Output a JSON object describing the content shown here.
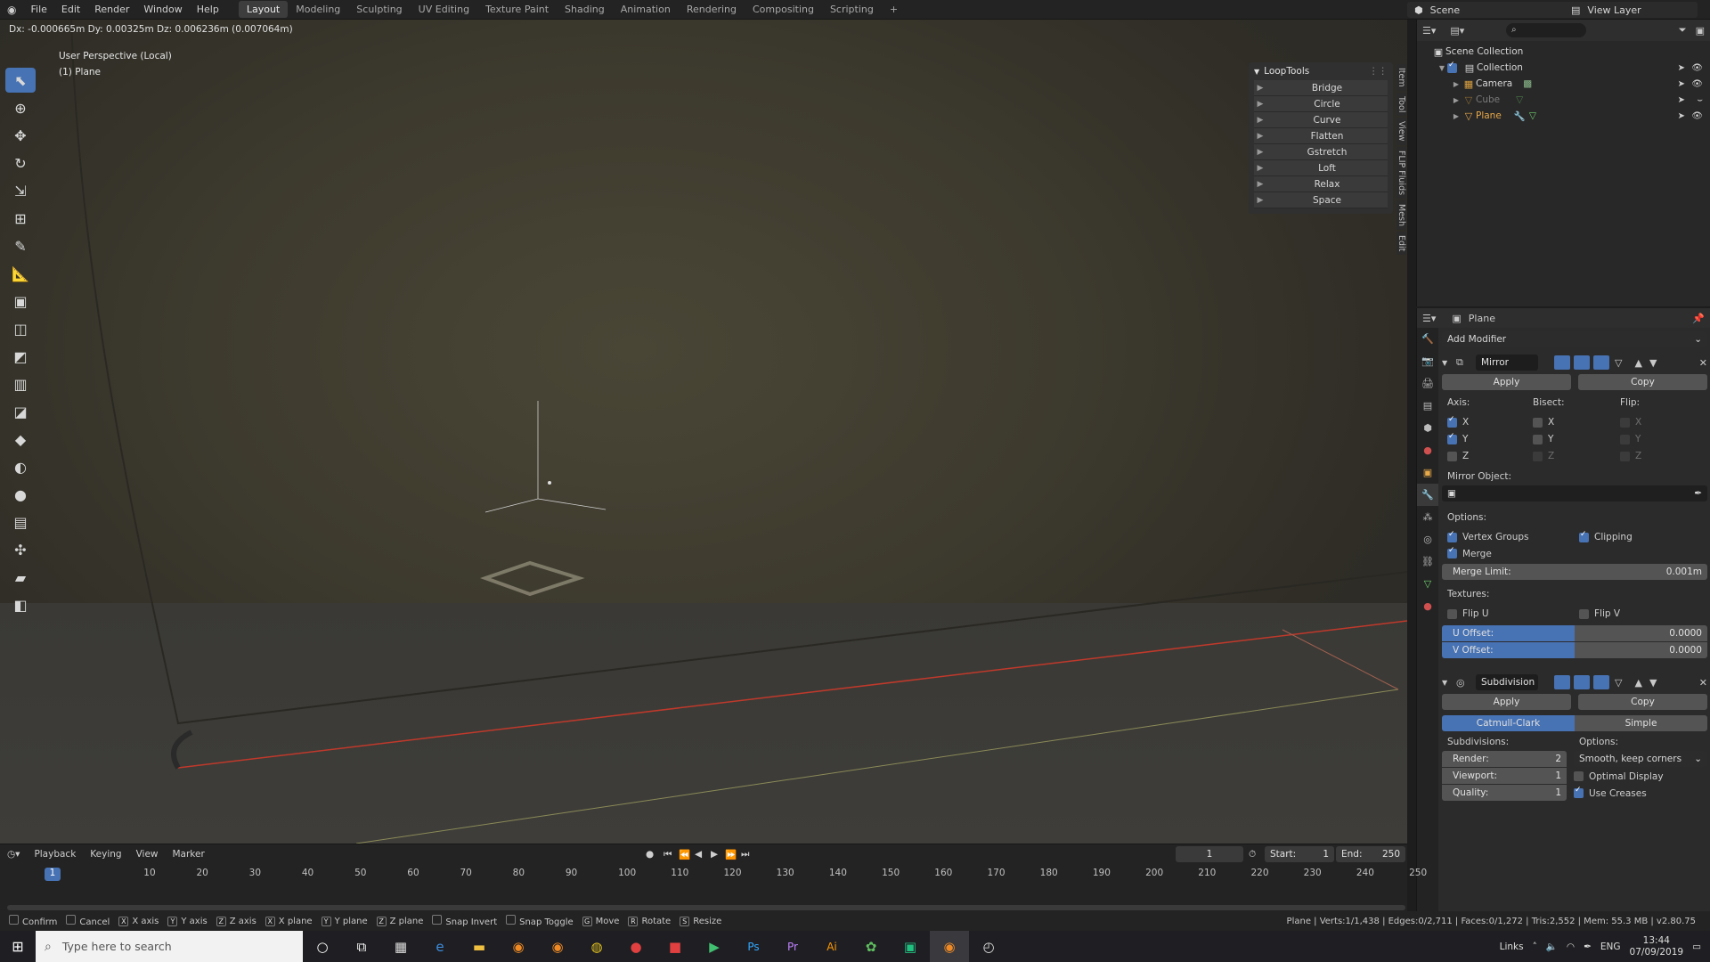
{
  "topbar": {
    "menus": [
      "File",
      "Edit",
      "Render",
      "Window",
      "Help"
    ],
    "workspaces": [
      "Layout",
      "Modeling",
      "Sculpting",
      "UV Editing",
      "Texture Paint",
      "Shading",
      "Animation",
      "Rendering",
      "Compositing",
      "Scripting"
    ],
    "active_workspace": "Layout",
    "scene": "Scene",
    "view_layer": "View Layer"
  },
  "viewport": {
    "header_text": "Dx: -0.000665m  Dy: 0.00325m  Dz: 0.006236m (0.007064m)",
    "perspective": "User Perspective (Local)",
    "object": "(1) Plane"
  },
  "looptools": {
    "title": "LoopTools",
    "items": [
      "Bridge",
      "Circle",
      "Curve",
      "Flatten",
      "Gstretch",
      "Loft",
      "Relax",
      "Space"
    ]
  },
  "side_tabs": [
    "Item",
    "Tool",
    "View",
    "FLIP Fluids",
    "Mesh",
    "Edit"
  ],
  "outliner": {
    "root": "Scene Collection",
    "collection": "Collection",
    "items": [
      {
        "name": "Camera",
        "color": "#d6d6d6"
      },
      {
        "name": "Cube",
        "color": "#7a7a7a"
      },
      {
        "name": "Plane",
        "color": "#e8a94a"
      }
    ]
  },
  "properties": {
    "object": "Plane",
    "add_modifier": "Add Modifier",
    "mirror": {
      "name": "Mirror",
      "apply": "Apply",
      "copy": "Copy",
      "axis_label": "Axis:",
      "bisect_label": "Bisect:",
      "flip_label": "Flip:",
      "axis": [
        "X",
        "Y",
        "Z"
      ],
      "mirror_object_label": "Mirror Object:",
      "options_label": "Options:",
      "vertex_groups": "Vertex Groups",
      "clipping": "Clipping",
      "merge": "Merge",
      "merge_limit_label": "Merge Limit:",
      "merge_limit": "0.001m",
      "textures_label": "Textures:",
      "flip_u": "Flip U",
      "flip_v": "Flip V",
      "u_offset_label": "U Offset:",
      "u_offset": "0.0000",
      "v_offset_label": "V Offset:",
      "v_offset": "0.0000"
    },
    "subdivision": {
      "name": "Subdivision",
      "apply": "Apply",
      "copy": "Copy",
      "catmull": "Catmull-Clark",
      "simple": "Simple",
      "subdivisions_label": "Subdivisions:",
      "options_label": "Options:",
      "render_label": "Render:",
      "render": "2",
      "viewport_label": "Viewport:",
      "viewport": "1",
      "quality_label": "Quality:",
      "quality": "1",
      "uv_smooth": "Smooth, keep corners",
      "optimal_display": "Optimal Display",
      "use_creases": "Use Creases"
    }
  },
  "timeline": {
    "menus": [
      "Playback",
      "Keying",
      "View",
      "Marker"
    ],
    "current_frame": "1",
    "start_label": "Start:",
    "start": "1",
    "end_label": "End:",
    "end": "250",
    "ticks": [
      "10",
      "20",
      "30",
      "40",
      "50",
      "60",
      "70",
      "80",
      "90",
      "100",
      "110",
      "120",
      "130",
      "140",
      "150",
      "160",
      "170",
      "180",
      "190",
      "200",
      "210",
      "220",
      "230",
      "240",
      "250"
    ],
    "frame_marker": "1"
  },
  "statusbar": {
    "items": [
      {
        "key": "",
        "label": "Confirm"
      },
      {
        "key": "",
        "label": "Cancel"
      },
      {
        "key": "X",
        "label": "X axis"
      },
      {
        "key": "Y",
        "label": "Y axis"
      },
      {
        "key": "Z",
        "label": "Z axis"
      },
      {
        "key": "X",
        "label": "X plane"
      },
      {
        "key": "Y",
        "label": "Y plane"
      },
      {
        "key": "Z",
        "label": "Z plane"
      },
      {
        "key": "",
        "label": "Snap Invert"
      },
      {
        "key": "",
        "label": "Snap Toggle"
      },
      {
        "key": "G",
        "label": "Move"
      },
      {
        "key": "R",
        "label": "Rotate"
      },
      {
        "key": "S",
        "label": "Resize"
      }
    ],
    "stats": "Plane | Verts:1/1,438 | Edges:0/2,711 | Faces:0/1,272 | Tris:2,552 | Mem: 55.3 MB | v2.80.75"
  },
  "taskbar": {
    "search_placeholder": "Type here to search",
    "links": "Links",
    "lang": "ENG",
    "time": "13:44",
    "date": "07/09/2019"
  }
}
